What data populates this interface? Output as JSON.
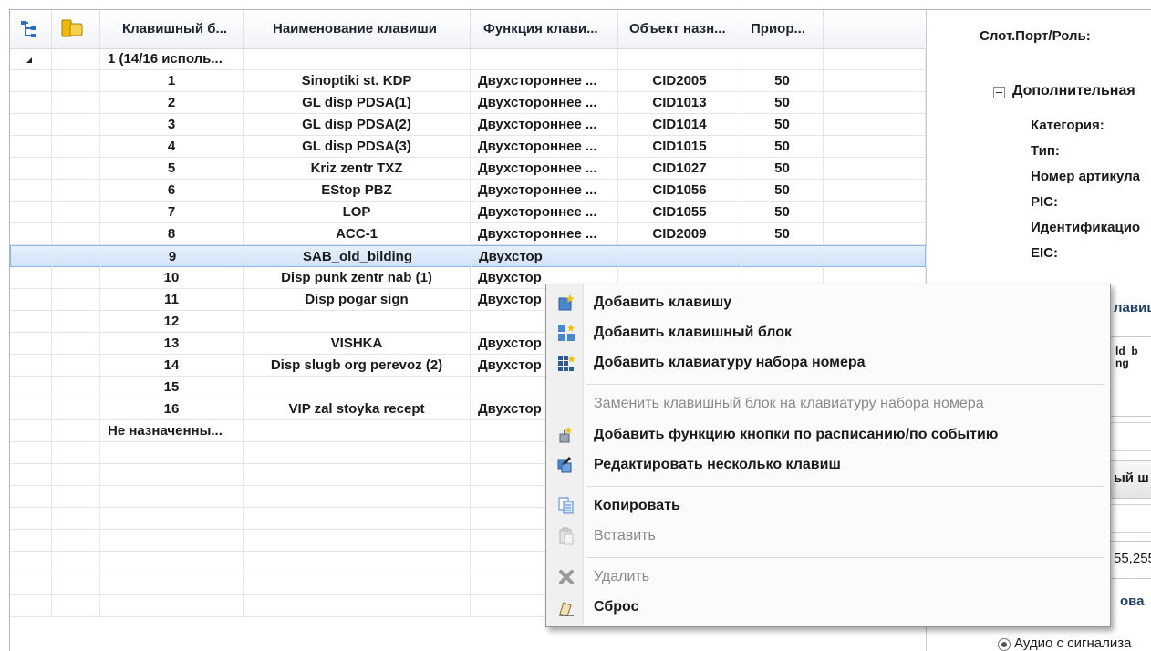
{
  "columns": [
    "Клавишный б...",
    "Наименование клавиши",
    "Функция клави...",
    "Объект назн...",
    "Приор..."
  ],
  "group_label": "1 (14/16 исполь...",
  "unassigned_label": "Не назначенны...",
  "rows": [
    {
      "num": "1",
      "name": "Sinoptiki st. KDP",
      "func": "Двухстороннее ...",
      "obj": "CID2005",
      "prio": "50"
    },
    {
      "num": "2",
      "name": "GL disp PDSA(1)",
      "func": "Двухстороннее ...",
      "obj": "CID1013",
      "prio": "50"
    },
    {
      "num": "3",
      "name": "GL disp PDSA(2)",
      "func": "Двухстороннее ...",
      "obj": "CID1014",
      "prio": "50"
    },
    {
      "num": "4",
      "name": "GL disp PDSA(3)",
      "func": "Двухстороннее ...",
      "obj": "CID1015",
      "prio": "50"
    },
    {
      "num": "5",
      "name": "Kriz zentr TXZ",
      "func": "Двухстороннее ...",
      "obj": "CID1027",
      "prio": "50"
    },
    {
      "num": "6",
      "name": "EStop PBZ",
      "func": "Двухстороннее ...",
      "obj": "CID1056",
      "prio": "50"
    },
    {
      "num": "7",
      "name": "LOP",
      "func": "Двухстороннее ...",
      "obj": "CID1055",
      "prio": "50"
    },
    {
      "num": "8",
      "name": "ACC-1",
      "func": "Двухстороннее ...",
      "obj": "CID2009",
      "prio": "50"
    },
    {
      "num": "9",
      "name": "SAB_old_bilding",
      "func": "Двухстор",
      "obj": "",
      "prio": ""
    },
    {
      "num": "10",
      "name": "Disp punk zentr nab (1)",
      "func": "Двухстор",
      "obj": "",
      "prio": ""
    },
    {
      "num": "11",
      "name": "Disp pogar sign",
      "func": "Двухстор",
      "obj": "",
      "prio": ""
    },
    {
      "num": "12",
      "name": "",
      "func": "",
      "obj": "",
      "prio": ""
    },
    {
      "num": "13",
      "name": "VISHKA",
      "func": "Двухстор",
      "obj": "",
      "prio": ""
    },
    {
      "num": "14",
      "name": "Disp slugb org perevoz (2)",
      "func": "Двухстор",
      "obj": "",
      "prio": ""
    },
    {
      "num": "15",
      "name": "",
      "func": "",
      "obj": "",
      "prio": ""
    },
    {
      "num": "16",
      "name": "VIP zal stoyka recept",
      "func": "Двухстор",
      "obj": "",
      "prio": ""
    }
  ],
  "panel": {
    "slot_label": "Слот.Порт/Роль:",
    "section_title": "Дополнительная",
    "fields": [
      "Категория:",
      "Тип:",
      "Номер артикула",
      "PIC:",
      "Идентификацио",
      "EIC:"
    ],
    "fragment1": "лавиц",
    "fragment2a": "ld_b",
    "fragment2b": "ng",
    "fragment3": "ый ш",
    "fragment4": "55,255",
    "fragment5": "ова",
    "radio_label": "Аудио с сигнализа"
  },
  "menu": {
    "items": [
      {
        "label": "Добавить клавишу",
        "enabled": true,
        "icon": "add-key-icon"
      },
      {
        "label": "Добавить клавишный блок",
        "enabled": true,
        "icon": "add-key-block-icon"
      },
      {
        "label": "Добавить клавиатуру набора номера",
        "enabled": true,
        "icon": "add-dialpad-icon"
      },
      {
        "label": "Заменить клавишный блок на клавиатуру набора номера",
        "enabled": false,
        "icon": ""
      },
      {
        "label": "Добавить функцию кнопки по расписанию/по событию",
        "enabled": true,
        "icon": "add-schedule-function-icon"
      },
      {
        "label": "Редактировать несколько клавиш",
        "enabled": true,
        "icon": "edit-multiple-keys-icon"
      },
      {
        "label": "Копировать",
        "enabled": true,
        "icon": "copy-icon"
      },
      {
        "label": "Вставить",
        "enabled": false,
        "icon": "paste-icon"
      },
      {
        "label": "Удалить",
        "enabled": false,
        "icon": "delete-icon"
      },
      {
        "label": "Сброс",
        "enabled": true,
        "icon": "reset-icon"
      }
    ]
  },
  "colors": {
    "selection": "#cfe3f8",
    "accent": "#2b6cc4"
  }
}
